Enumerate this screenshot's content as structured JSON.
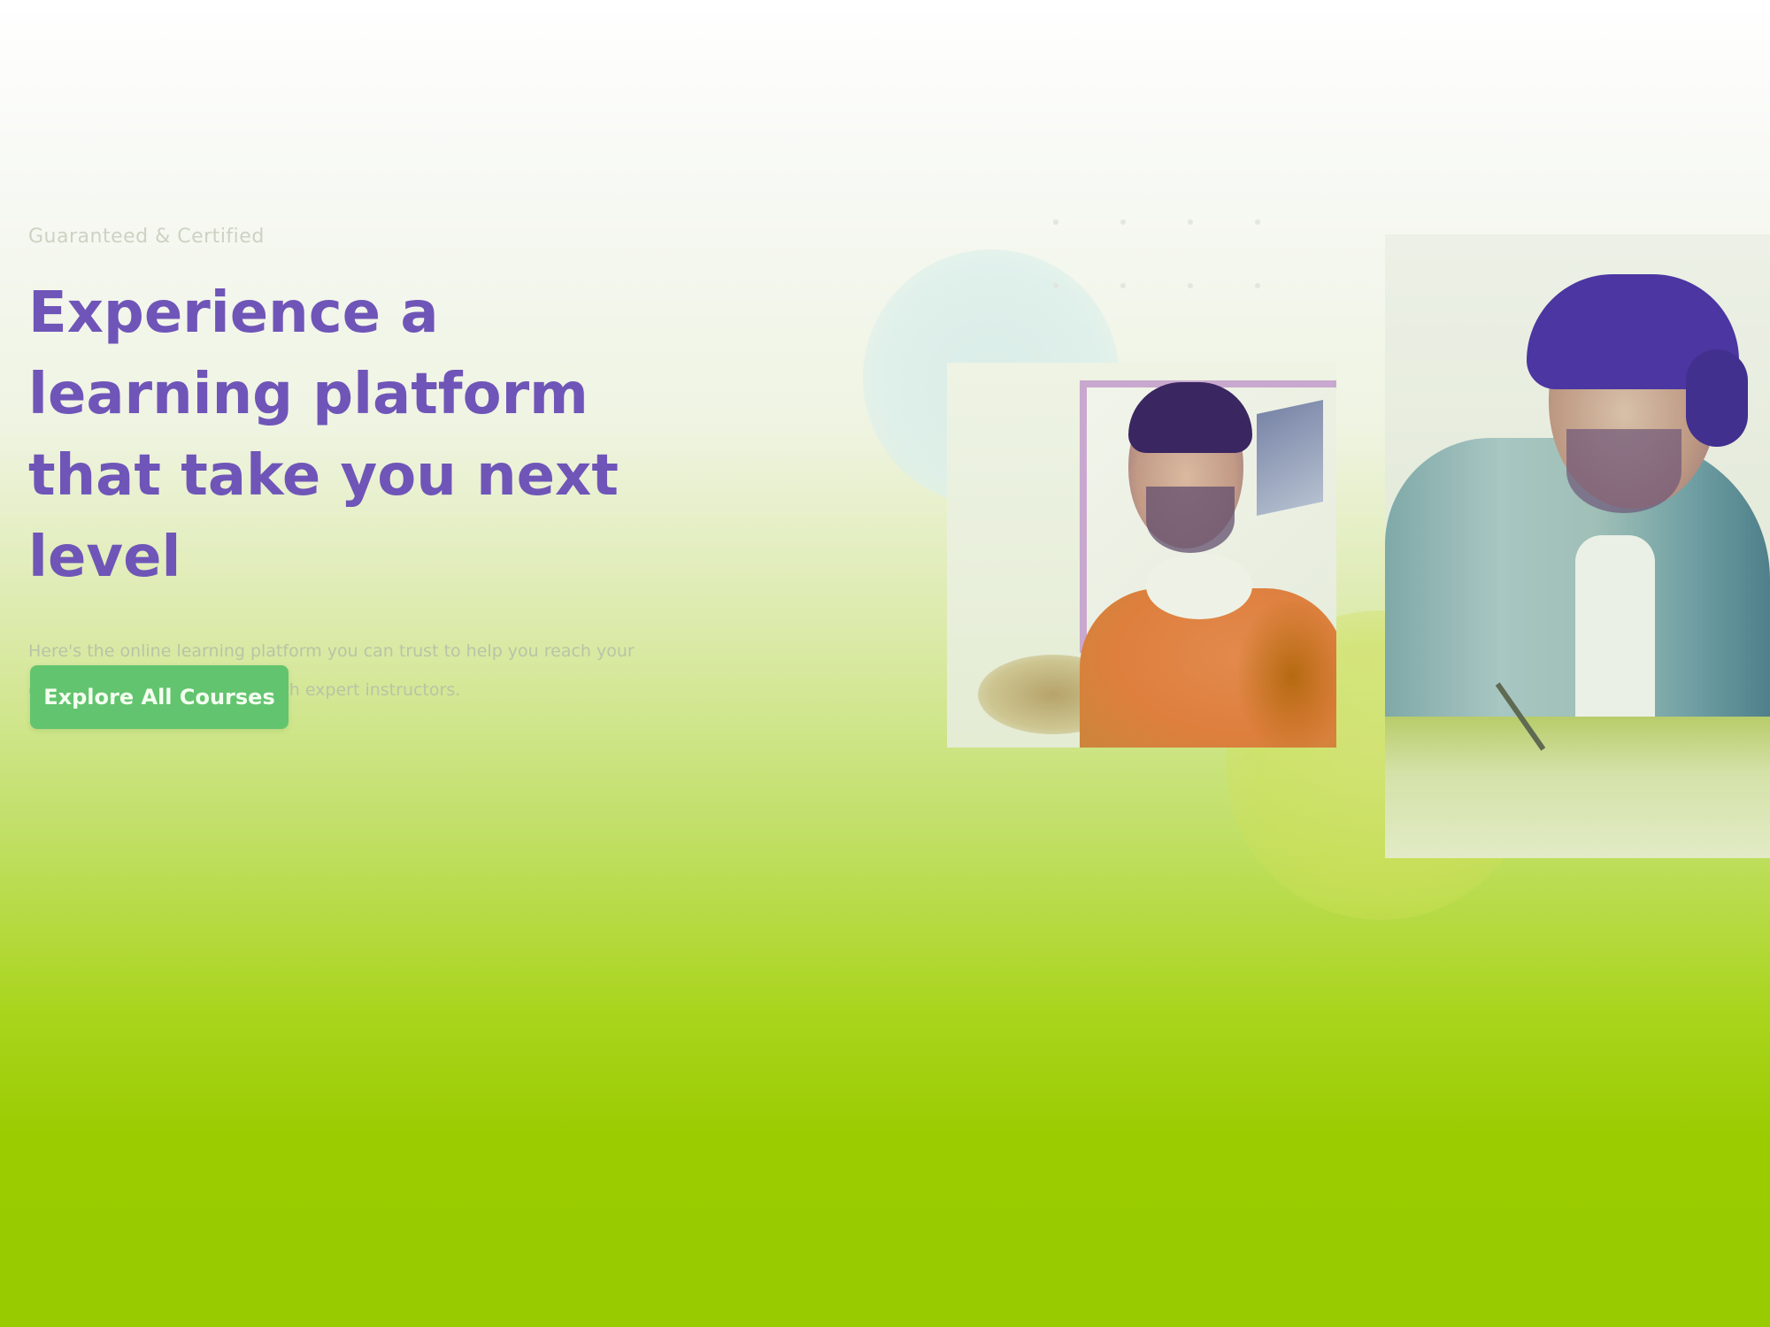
{
  "hero": {
    "eyebrow": "Guaranteed & Certified",
    "headline": "Experience a learning platform that take you next level",
    "subtext": "Here's the online learning platform you can trust to help you reach your goals and grow your career with expert instructors.",
    "cta_label": "Explore All Courses"
  },
  "colors": {
    "headline": "#6f55b8",
    "cta_background": "#63c46f",
    "background_top": "#ffffff",
    "background_bottom": "#98cc00"
  },
  "images": [
    {
      "name": "student-with-headphones-photo"
    },
    {
      "name": "student-writing-photo"
    }
  ]
}
